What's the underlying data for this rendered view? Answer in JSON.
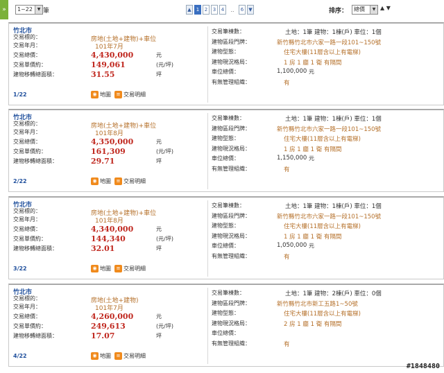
{
  "toolbar": {
    "collapse_icon": "»",
    "range_value": "1~22",
    "range_unit": "筆",
    "pages": [
      "1",
      "2",
      "3",
      "4",
      "6"
    ],
    "active_page": "1",
    "ellipsis": "..",
    "prev_icon": "▲",
    "next_icon": "▼",
    "sort_label": "排序：",
    "sort_value": "總價",
    "sort_asc": "▲",
    "sort_desc": "▼"
  },
  "labels": {
    "target": "交易標的：",
    "year_month": "交易年月：",
    "total_price": "交易總價：",
    "unit_price": "交易單價約：",
    "area": "建物移轉總面積：",
    "unit_yuan": "元",
    "unit_ping_price": "(元/坪)",
    "unit_ping": "坪",
    "map": "地圖",
    "detail": "交易明細",
    "r_count": "交易筆棟數：",
    "r_address": "建物區段門牌：",
    "r_type": "建物型態：",
    "r_layout": "建物現況格局：",
    "r_parking": "車位總價：",
    "r_management": "有無管理組織："
  },
  "listings": [
    {
      "city": "竹北市",
      "target": "房地(土地+建物)+車位",
      "year_month": "101年7月",
      "total_price": "4,430,000",
      "unit_price": "149,061",
      "area": "31.55",
      "index": "1/22",
      "count": "土地：1筆 建物：1棟(戶) 車位：1個",
      "address": "新竹縣竹北市六家一路一段101~150號",
      "type": "住宅大樓(11層含以上有電梯)",
      "layout": "1 房 1 廳 1 衛 有隔間",
      "parking": "1,100,000",
      "parking_unit": "元",
      "management": "有"
    },
    {
      "city": "竹北市",
      "target": "房地(土地+建物)+車位",
      "year_month": "101年8月",
      "total_price": "4,350,000",
      "unit_price": "161,309",
      "area": "29.71",
      "index": "2/22",
      "count": "土地：1筆 建物：1棟(戶) 車位：1個",
      "address": "新竹縣竹北市六家一路一段101~150號",
      "type": "住宅大樓(11層含以上有電梯)",
      "layout": "1 房 1 廳 1 衛 有隔間",
      "parking": "1,150,000",
      "parking_unit": "元",
      "management": "有"
    },
    {
      "city": "竹北市",
      "target": "房地(土地+建物)+車位",
      "year_month": "101年8月",
      "total_price": "4,340,000",
      "unit_price": "144,340",
      "area": "32.01",
      "index": "3/22",
      "count": "土地：1筆 建物：1棟(戶) 車位：1個",
      "address": "新竹縣竹北市六家一路一段101~150號",
      "type": "住宅大樓(11層含以上有電梯)",
      "layout": "1 房 1 廳 1 衛 有隔間",
      "parking": "1,050,000",
      "parking_unit": "元",
      "management": "有"
    },
    {
      "city": "竹北市",
      "target": "房地(土地+建物)",
      "year_month": "101年7月",
      "total_price": "4,260,000",
      "unit_price": "249,613",
      "area": "17.07",
      "index": "4/22",
      "count": "土地：1筆 建物：2棟(戶) 車位：0個",
      "address": "新竹縣竹北市新工五路1~50號",
      "type": "住宅大樓(11層含以上有電梯)",
      "layout": "2 房 1 廳 1 衛 有隔間",
      "parking": "",
      "parking_unit": "",
      "management": "有"
    }
  ],
  "watermark": "#1848480"
}
